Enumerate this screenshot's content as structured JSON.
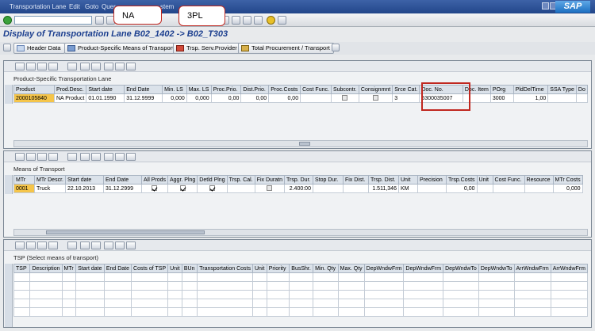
{
  "menubar": {
    "items": [
      "Transportation Lane",
      "Edit",
      "Goto",
      "Quer",
      "stem"
    ]
  },
  "brand": "SAP",
  "title": "Display of Transportation Lane B02_1402 -> B02_T303",
  "callouts": {
    "na": "NA",
    "tpl": "3PL"
  },
  "toolbar_buttons": {
    "header_data": "Header Data",
    "product_mot": "Product-Specific Means of Transport",
    "trsp_serv": "Trsp. Serv.Provider",
    "total_proc": "Total Procurement / Transport"
  },
  "section1": {
    "title": "Product-Specific Transportation Lane",
    "columns": [
      "Product",
      "Prod.Desc.",
      "Start date",
      "End Date",
      "Min. LS",
      "Max. LS",
      "Proc.Prio.",
      "Dist.Prio.",
      "Proc.Costs",
      "Cost Func.",
      "Subcontr.",
      "Consignmnt",
      "Srce Cat.",
      "Doc. No.",
      "Doc. Item",
      "POrg",
      "PldDelTime",
      "SSA Type",
      "Do"
    ],
    "rows": [
      [
        "2000105840",
        "NA Product",
        "01.01.1990",
        "31.12.9999",
        "0,000",
        "0,000",
        "0,00",
        "0,00",
        "0,00",
        "",
        "",
        "",
        "3",
        "5300035007",
        "",
        "3000",
        "1,00",
        "",
        ""
      ]
    ]
  },
  "section2": {
    "title": "Means of Transport",
    "columns": [
      "MTr",
      "MTr Descr.",
      "Start date",
      "End Date",
      "All Prods",
      "Aggr. Plng",
      "Detld Plng",
      "Trsp. Cal.",
      "Fix Duratn",
      "Trsp. Dur.",
      "Stop Dur.",
      "Fix Dist.",
      "Trsp. Dist.",
      "Unit",
      "Precision",
      "Trsp.Costs",
      "Unit",
      "Cost Func.",
      "Resource",
      "MTr Costs"
    ],
    "rows": [
      [
        "0001",
        "Truck",
        "22.10.2013",
        "31.12.2999",
        "",
        "",
        "",
        "",
        "",
        "2.400:00",
        "",
        "",
        "1.511,346",
        "KM",
        "",
        "0,00",
        "",
        "",
        "",
        "0,000"
      ]
    ]
  },
  "section3": {
    "title": "TSP (Select means of transport)",
    "columns": [
      "TSP",
      "Description",
      "MTr",
      "Start date",
      "End Date",
      "Costs of TSP",
      "Unit",
      "BUn",
      "Transportation Costs",
      "Unit",
      "Priority",
      "BusShr.",
      "Min. Qty",
      "Max. Qty",
      "DepWndwFrm",
      "DepWndwFrm",
      "DepWndwTo",
      "DepWndwTo",
      "ArrWndwFrm",
      "ArrWndwFrm"
    ]
  },
  "colors": {
    "menubar": "#2d519a",
    "title": "#1c3f8f",
    "key_cell": "#f5c54a",
    "callout_border": "#c0271f"
  }
}
